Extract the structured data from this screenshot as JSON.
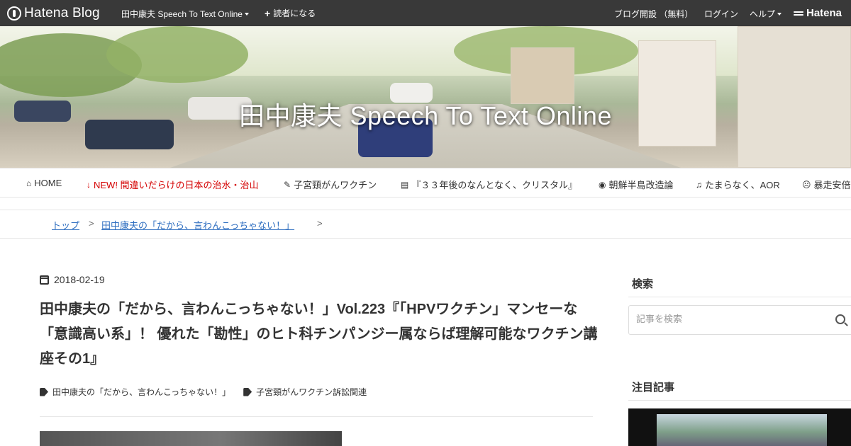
{
  "topbar": {
    "brand": "Hatena Blog",
    "blog_menu": "田中康夫 Speech To Text Online",
    "subscribe": "読者になる",
    "open_blog": "ブログ開設 （無料）",
    "login": "ログイン",
    "help": "ヘルプ",
    "hatena": "Hatena"
  },
  "header": {
    "title": "田中康夫 Speech To Text Online"
  },
  "nav": {
    "items": [
      {
        "icon": "home-icon",
        "label": "HOME"
      },
      {
        "icon": "sort-icon",
        "label": "NEW! 間違いだらけの日本の治水・治山"
      },
      {
        "icon": "syringe-icon",
        "label": "子宮頸がんワクチン"
      },
      {
        "icon": "book-icon",
        "label": "『３３年後のなんとなく、クリスタル』"
      },
      {
        "icon": "eye-icon",
        "label": "朝鮮半島改造論"
      },
      {
        "icon": "music-icon",
        "label": "たまらなく、AOR"
      },
      {
        "icon": "frown-icon",
        "label": "暴走安倍"
      }
    ]
  },
  "breadcrumb": {
    "items": [
      "トップ",
      "田中康夫の「だから、言わんこっちゃない！」"
    ],
    "separator": ">"
  },
  "article": {
    "date": "2018-02-19",
    "title": "田中康夫の「だから、言わんこっちゃない！」Vol.223『「HPVワクチン」マンセーな「意識高い系」！ 優れた「勘性」のヒト科チンパンジー属ならば理解可能なワクチン講座その1』",
    "tags": [
      "田中康夫の「だから、言わんこっちゃない！」",
      "子宮頸がんワクチン訴訟関連"
    ]
  },
  "sidebar": {
    "search_title": "検索",
    "search_placeholder": "記事を検索",
    "popular_title": "注目記事"
  }
}
